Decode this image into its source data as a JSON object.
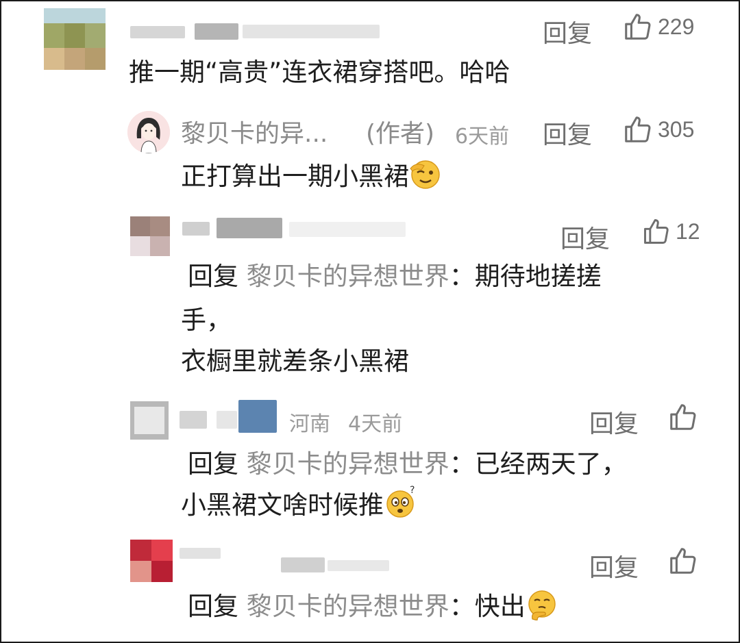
{
  "comments": [
    {
      "text": "推一期“高贵”连衣裙穿搭吧。哈哈",
      "reply_label": "回复",
      "likes": "229"
    },
    {
      "author": "黎贝卡的异...",
      "author_tag": "(作者)",
      "time": "6天前",
      "text": "正打算出一期小黑裙",
      "reply_label": "回复",
      "likes": "305",
      "emoji": "wink-emoji"
    },
    {
      "reply_prefix": "回复",
      "reply_target": "黎贝卡的异想世界",
      "text_line1": "：期待地搓搓",
      "text_line2": "手，",
      "text_line3": "衣橱里就差条小黑裙",
      "reply_label": "回复",
      "likes": "12"
    },
    {
      "location": "河南",
      "time": "4天前",
      "reply_prefix": "回复",
      "reply_target": "黎贝卡的异想世界",
      "text_line1": "：已经两天了，",
      "text_line2": "小黑裙文啥时候推",
      "reply_label": "回复",
      "emoji": "confused-emoji"
    },
    {
      "reply_prefix": "回复",
      "reply_target": "黎贝卡的异想世界",
      "text_line1": "：快出",
      "reply_label": "回复",
      "emoji": "thinking-emoji"
    }
  ],
  "colors": {
    "text_primary": "#1e1e1e",
    "text_secondary": "#8a8a8a",
    "action": "#6f6f6f"
  }
}
